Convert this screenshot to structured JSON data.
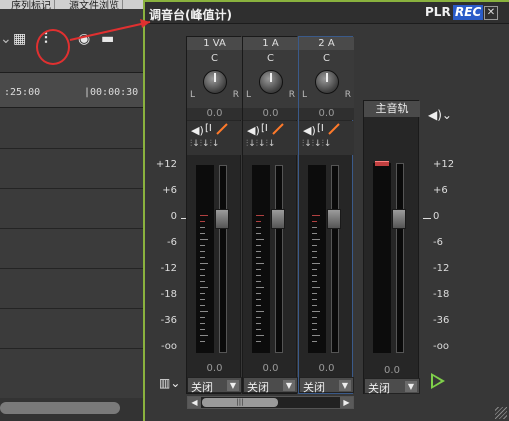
{
  "timeline": {
    "tabs": [
      "序列标记",
      "源文件浏览"
    ],
    "timecodes": [
      ":25:00",
      "|00:00:30"
    ],
    "icons": [
      "grid-icon",
      "mixer-icon",
      "color-icon",
      "layout-menu-icon"
    ]
  },
  "mixer": {
    "title": "调音台(峰值计)",
    "plr": "PLR",
    "rec": "REC",
    "channels": [
      {
        "name": "1 VA",
        "pan_center": "C",
        "pan_left": "L",
        "pan_right": "R",
        "pan_value": "0.0",
        "fader_value": "0.0",
        "mode": "关闭"
      },
      {
        "name": "1 A",
        "pan_center": "C",
        "pan_left": "L",
        "pan_right": "R",
        "pan_value": "0.0",
        "fader_value": "0.0",
        "mode": "关闭"
      },
      {
        "name": "2 A",
        "pan_center": "C",
        "pan_left": "L",
        "pan_right": "R",
        "pan_value": "0.0",
        "fader_value": "0.0",
        "mode": "关闭"
      }
    ],
    "master": {
      "name": "主音轨",
      "fader_value": "0.0",
      "mode": "关闭"
    },
    "db_scale": [
      "+12",
      "+6",
      "0",
      "-6",
      "-12",
      "-18",
      "-36",
      "-oo"
    ],
    "fader_level_db": 0,
    "scroll_arrows": {
      "left": "◀",
      "right": "▶",
      "thumb": "|||"
    },
    "accent_color": "#8ab23e",
    "highlight_color": "#e03030",
    "rec_color": "#2a5cc8"
  }
}
